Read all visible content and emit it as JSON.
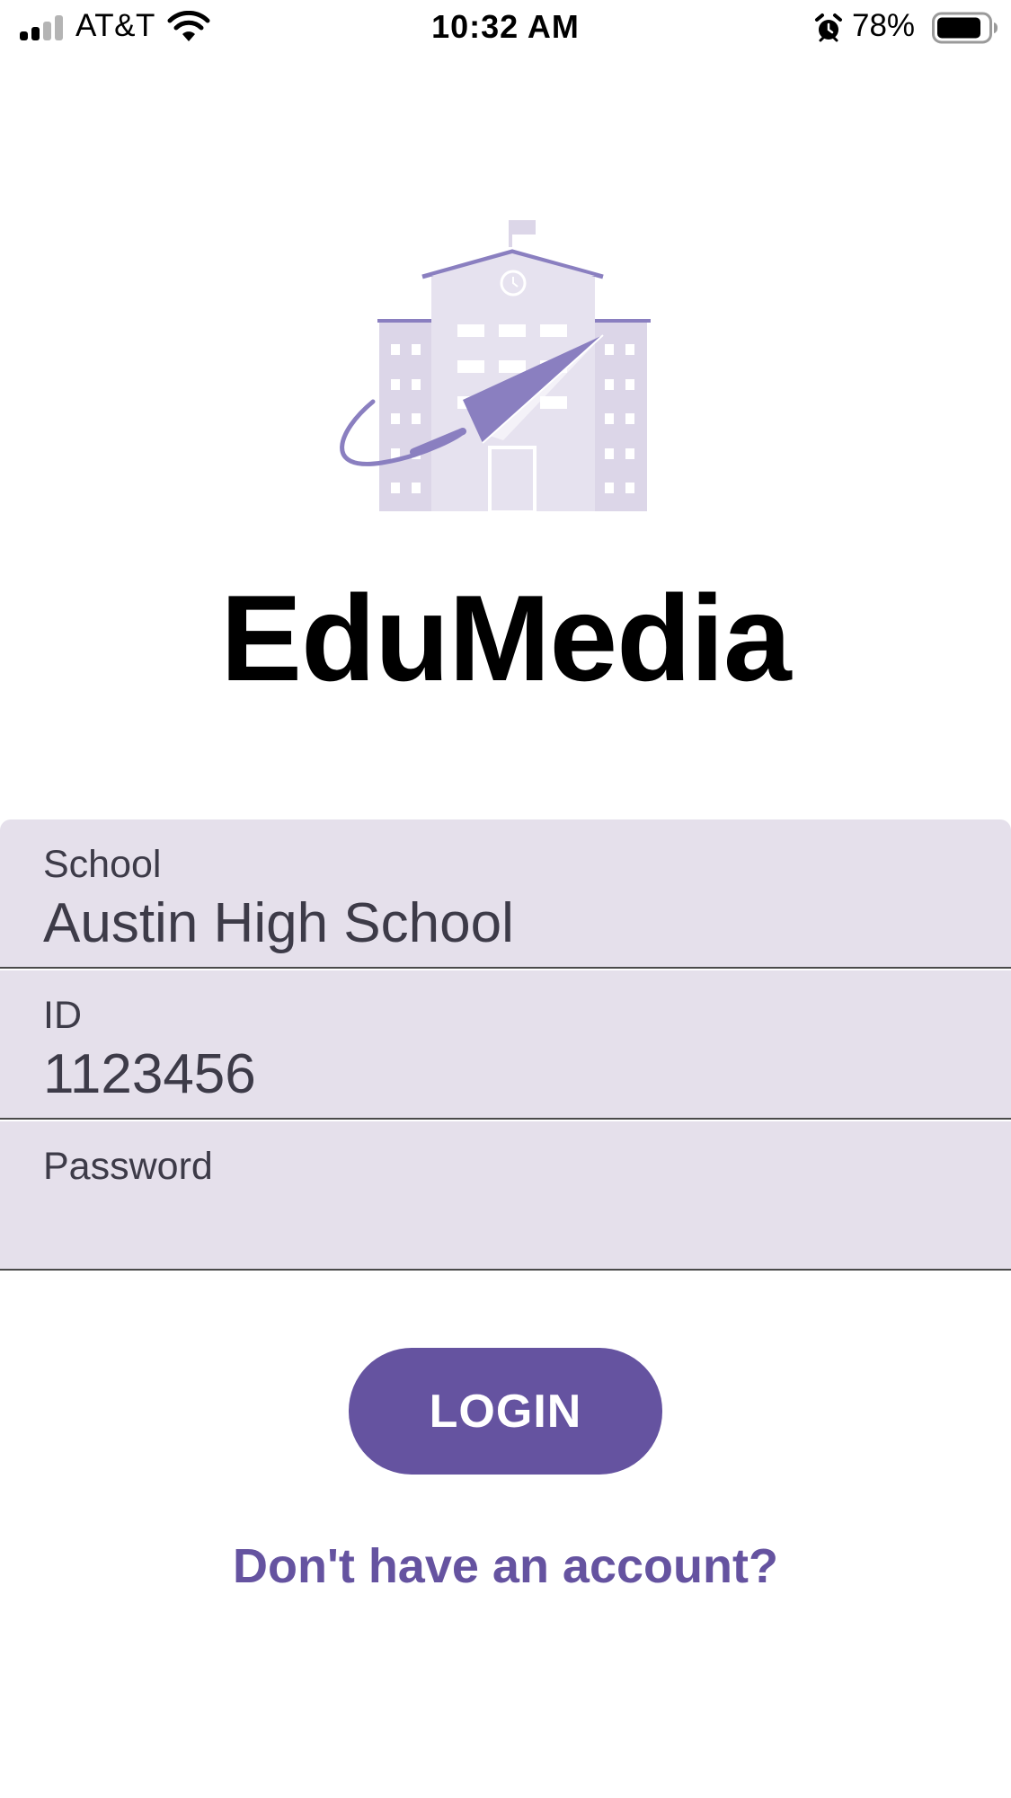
{
  "status_bar": {
    "carrier": "AT&T",
    "time": "10:32 AM",
    "battery_percent": "78%",
    "icons": [
      "signal-icon",
      "wifi-icon",
      "alarm-icon",
      "battery-icon"
    ]
  },
  "app": {
    "title": "EduMedia",
    "logo": "school-building-paper-plane-logo"
  },
  "form": {
    "school": {
      "label": "School",
      "value": "Austin High School"
    },
    "id": {
      "label": "ID",
      "value": "1123456"
    },
    "password": {
      "label": "Password",
      "value": ""
    }
  },
  "actions": {
    "login_label": "LOGIN",
    "signup_link": "Don't have an account?"
  },
  "colors": {
    "accent": "#6553a0",
    "field_background": "#e5e0eb",
    "logo_light": "#dcd6e8",
    "logo_dark": "#8a7fc0"
  }
}
